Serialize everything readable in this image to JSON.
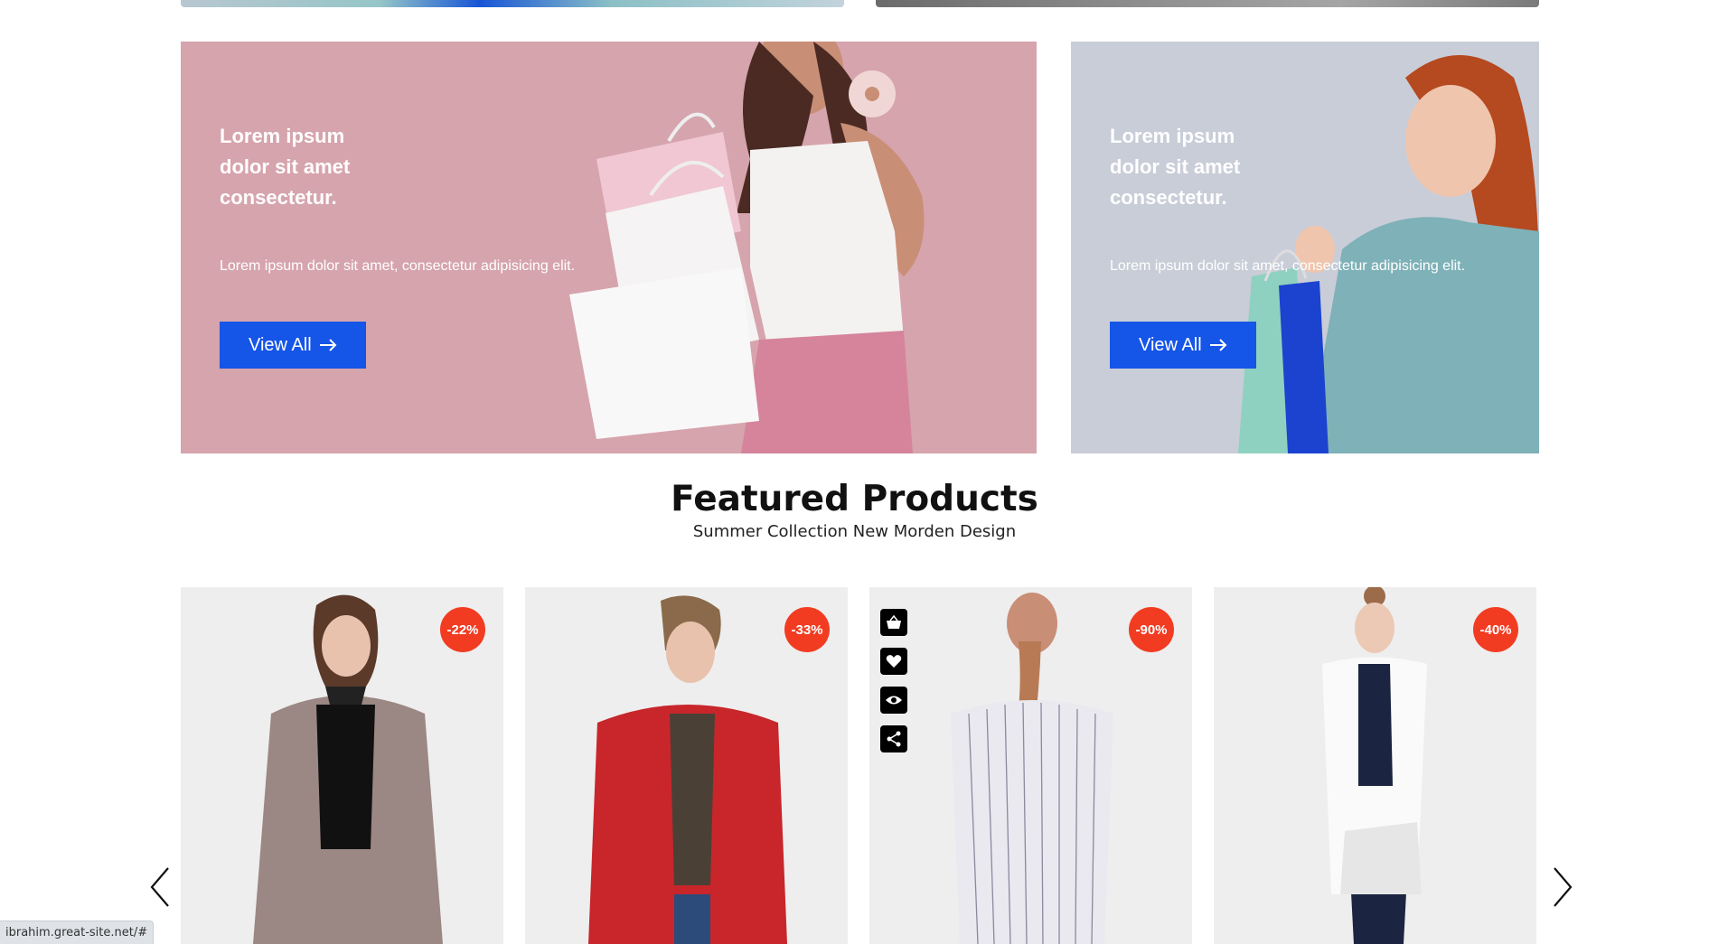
{
  "banners": [
    {
      "title": "Lorem ipsum\ndolor sit amet\nconsectetur.",
      "description": "Lorem ipsum dolor sit amet, consectetur adipisicing elit.",
      "button_label": "View All"
    },
    {
      "title": "Lorem ipsum\ndolor sit amet\nconsectetur.",
      "description": "Lorem ipsum dolor sit amet, consectetur adipisicing elit.",
      "button_label": "View All"
    }
  ],
  "featured": {
    "title": "Featured Products",
    "subtitle": "Summer Collection New Morden Design"
  },
  "products": [
    {
      "discount": "-22%"
    },
    {
      "discount": "-33%"
    },
    {
      "discount": "-90%"
    },
    {
      "discount": "-40%"
    }
  ],
  "product_actions": [
    "basket-icon",
    "heart-icon",
    "eye-icon",
    "share-icon"
  ],
  "status_bar": {
    "url": "ibrahim.great-site.net/#"
  },
  "colors": {
    "accent_button": "#1555e8",
    "badge": "#f23c22",
    "pink_banner": "#d6a4ad",
    "blue_banner": "#c9cdd8"
  }
}
